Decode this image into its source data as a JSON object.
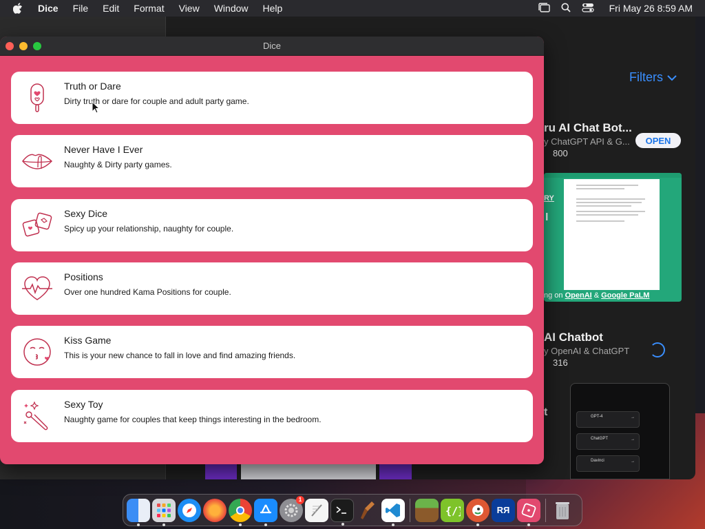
{
  "menubar": {
    "app_name": "Dice",
    "items": [
      "File",
      "Edit",
      "Format",
      "View",
      "Window",
      "Help"
    ],
    "clock": "Fri May 26  8:59 AM"
  },
  "window": {
    "title": "Dice",
    "accent": "#e2496f"
  },
  "games": [
    {
      "name": "Truth or Dare",
      "description": "Dirty truth or dare for couple and adult party game.",
      "icon": "popsicle-heart-icon"
    },
    {
      "name": "Never Have I Ever",
      "description": "Naughty & Dirty party games.",
      "icon": "lips-icon"
    },
    {
      "name": "Sexy Dice",
      "description": "Spicy up your relationship, naughty for couple.",
      "icon": "dice-icon"
    },
    {
      "name": "Positions",
      "description": "Over one hundred Kama Positions for couple.",
      "icon": "heartbeat-icon"
    },
    {
      "name": "Kiss Game",
      "description": "This is your new chance to fall in love and find amazing friends.",
      "icon": "kiss-face-icon"
    },
    {
      "name": "Sexy Toy",
      "description": "Naughty game for couples that keep things interesting in the bedroom.",
      "icon": "toy-wand-icon"
    }
  ],
  "background_store": {
    "filters_label": "Filters",
    "app1_title": "ru AI Chat Bot...",
    "app1_subtitle": "y ChatGPT API & G...",
    "app1_rating_count": "800",
    "open_label": "OPEN",
    "banner_text_ry": "RY",
    "banner_text_i": "I",
    "banner_caption_prefix": "ng on ",
    "banner_caption_link1": "OpenAI",
    "banner_caption_mid": " & ",
    "banner_caption_link2": "Google PaLM",
    "app2_title": "AI Chatbot",
    "app2_subtitle": "y OpenAI & ChatGPT",
    "app2_rating_count": "316",
    "t_label": "t",
    "phone_rows": [
      "GPT-4",
      "ChatGPT",
      "Davinci"
    ]
  },
  "dock": {
    "items": [
      "finder-icon",
      "launchpad-icon",
      "safari-icon",
      "firefox-icon",
      "chrome-icon",
      "app-store-icon",
      "system-settings-icon",
      "textedit-icon",
      "terminal-icon",
      "instruments-icon",
      "vscode-icon",
      "minecraft-icon",
      "json-editor-icon",
      "duckduckgo-icon",
      "keyboard-layout-icon",
      "dice-app-icon",
      "trash-icon"
    ],
    "settings_badge": "1",
    "keyboard_label": "RЯ"
  }
}
